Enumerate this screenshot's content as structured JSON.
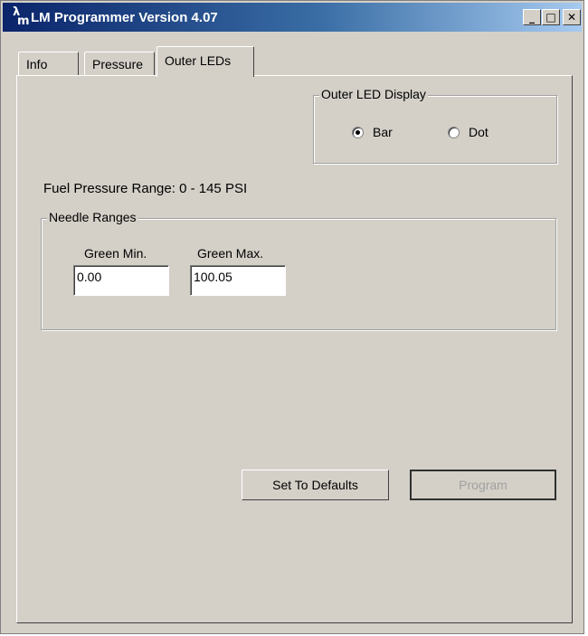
{
  "window": {
    "title": "LM Programmer Version 4.07",
    "icon": "lm-app-icon",
    "icon_glyphs": [
      "λ",
      "m"
    ],
    "controls": {
      "minimize": "_",
      "maximize": "□",
      "close": "✕"
    }
  },
  "tabs": [
    {
      "label": "Info",
      "active": false
    },
    {
      "label": "Pressure",
      "active": false
    },
    {
      "label": "Outer LEDs",
      "active": true
    }
  ],
  "outer_led_display": {
    "label": "Outer LED Display",
    "options": [
      {
        "label": "Bar",
        "checked": true
      },
      {
        "label": "Dot",
        "checked": false
      }
    ]
  },
  "fuel_pressure_range": "Fuel Pressure Range: 0 - 145 PSI",
  "needle_ranges": {
    "label": "Needle Ranges",
    "green_min": {
      "label": "Green Min.",
      "value": "0.00"
    },
    "green_max": {
      "label": "Green Max.",
      "value": "100.05"
    }
  },
  "buttons": {
    "set_defaults": "Set To Defaults",
    "program": "Program"
  }
}
